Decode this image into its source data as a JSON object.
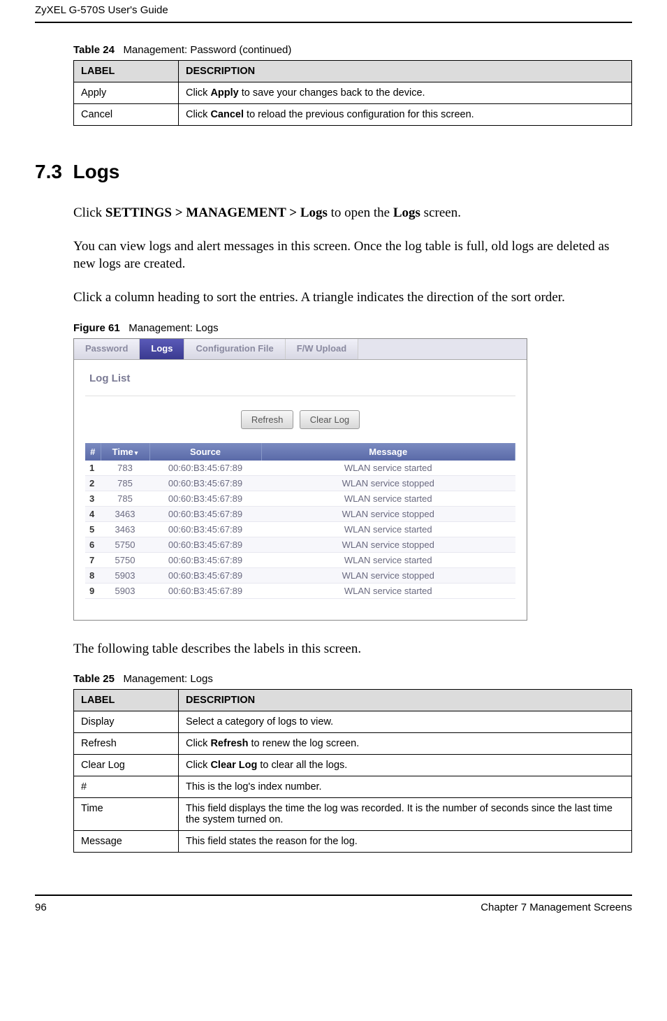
{
  "header": {
    "title": "ZyXEL G-570S User's Guide"
  },
  "table24": {
    "caption_label": "Table 24",
    "caption_text": "Management: Password  (continued)",
    "col_label": "LABEL",
    "col_desc": "DESCRIPTION",
    "rows": [
      {
        "label": "Apply",
        "desc_pre": "Click ",
        "desc_bold": "Apply",
        "desc_post": " to save your changes back to the device."
      },
      {
        "label": "Cancel",
        "desc_pre": "Click ",
        "desc_bold": "Cancel",
        "desc_post": " to reload the previous configuration for this screen."
      }
    ]
  },
  "section": {
    "number": "7.3",
    "title": "Logs",
    "p1_pre": "Click ",
    "p1_bold": "SETTINGS > MANAGEMENT > Logs",
    "p1_mid": " to open the ",
    "p1_bold2": "Logs",
    "p1_post": " screen.",
    "p2": "You can view logs and alert messages in this screen. Once the log table is full, old logs are deleted as new logs are created.",
    "p3": "Click a column heading to sort the entries. A triangle indicates the direction of the sort order."
  },
  "figure61": {
    "caption_label": "Figure 61",
    "caption_text": "Management: Logs",
    "tabs": {
      "password": "Password",
      "logs": "Logs",
      "config": "Configuration File",
      "fw": "F/W Upload"
    },
    "panel_title": "Log List",
    "btn_refresh": "Refresh",
    "btn_clear": "Clear Log",
    "cols": {
      "num": "#",
      "time": "Time",
      "source": "Source",
      "message": "Message"
    },
    "rows": [
      {
        "n": "1",
        "t": "783",
        "s": "00:60:B3:45:67:89",
        "m": "WLAN service started"
      },
      {
        "n": "2",
        "t": "785",
        "s": "00:60:B3:45:67:89",
        "m": "WLAN service stopped"
      },
      {
        "n": "3",
        "t": "785",
        "s": "00:60:B3:45:67:89",
        "m": "WLAN service started"
      },
      {
        "n": "4",
        "t": "3463",
        "s": "00:60:B3:45:67:89",
        "m": "WLAN service stopped"
      },
      {
        "n": "5",
        "t": "3463",
        "s": "00:60:B3:45:67:89",
        "m": "WLAN service started"
      },
      {
        "n": "6",
        "t": "5750",
        "s": "00:60:B3:45:67:89",
        "m": "WLAN service stopped"
      },
      {
        "n": "7",
        "t": "5750",
        "s": "00:60:B3:45:67:89",
        "m": "WLAN service started"
      },
      {
        "n": "8",
        "t": "5903",
        "s": "00:60:B3:45:67:89",
        "m": "WLAN service stopped"
      },
      {
        "n": "9",
        "t": "5903",
        "s": "00:60:B3:45:67:89",
        "m": "WLAN service started"
      }
    ]
  },
  "post_figure_text": "The following table describes the labels in this screen.",
  "table25": {
    "caption_label": "Table 25",
    "caption_text": "Management: Logs",
    "col_label": "LABEL",
    "col_desc": "DESCRIPTION",
    "rows": [
      {
        "label": "Display",
        "desc_pre": "Select a category of logs to view.",
        "desc_bold": "",
        "desc_post": ""
      },
      {
        "label": "Refresh",
        "desc_pre": "Click ",
        "desc_bold": "Refresh",
        "desc_post": " to renew the log screen."
      },
      {
        "label": "Clear Log",
        "desc_pre": "Click ",
        "desc_bold": "Clear Log",
        "desc_post": " to clear all the logs."
      },
      {
        "label": "#",
        "desc_pre": "This is the log's index number.",
        "desc_bold": "",
        "desc_post": ""
      },
      {
        "label": "Time",
        "desc_pre": "This field displays the time the log was recorded. It is the number of seconds since the last time the system turned on.",
        "desc_bold": "",
        "desc_post": ""
      },
      {
        "label": "Message",
        "desc_pre": "This field states the reason for the log.",
        "desc_bold": "",
        "desc_post": ""
      }
    ]
  },
  "footer": {
    "page": "96",
    "chapter": "Chapter 7 Management Screens"
  }
}
